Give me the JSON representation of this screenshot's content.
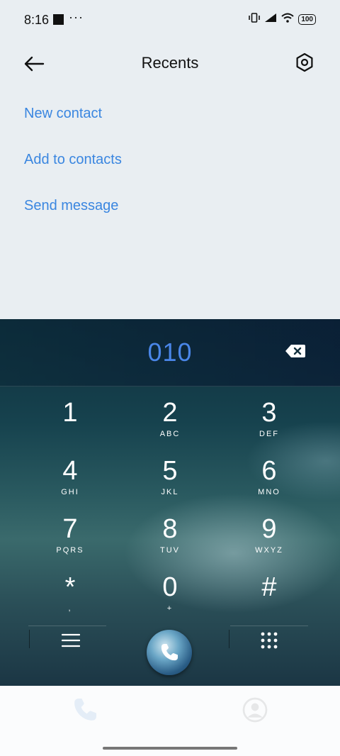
{
  "status_bar": {
    "time": "8:16",
    "dots": "···",
    "battery": "100"
  },
  "header": {
    "title": "Recents"
  },
  "actions": [
    {
      "label": "New contact"
    },
    {
      "label": "Add to contacts"
    },
    {
      "label": "Send message"
    }
  ],
  "dialer": {
    "entered_number": "010",
    "keys": [
      {
        "num": "1",
        "letters": ""
      },
      {
        "num": "2",
        "letters": "ABC"
      },
      {
        "num": "3",
        "letters": "DEF"
      },
      {
        "num": "4",
        "letters": "GHI"
      },
      {
        "num": "5",
        "letters": "JKL"
      },
      {
        "num": "6",
        "letters": "MNO"
      },
      {
        "num": "7",
        "letters": "PQRS"
      },
      {
        "num": "8",
        "letters": "TUV"
      },
      {
        "num": "9",
        "letters": "WXYZ"
      },
      {
        "num": "*",
        "letters": ","
      },
      {
        "num": "0",
        "letters": "+"
      },
      {
        "num": "#",
        "letters": ""
      }
    ]
  },
  "icons": {
    "back": "arrow-left-icon",
    "settings": "hexagon-gear-icon",
    "backspace": "backspace-icon",
    "menu": "hamburger-menu-icon",
    "call": "phone-call-icon",
    "dialpad": "dialpad-grid-icon",
    "recents_tab": "phone-icon",
    "contacts_tab": "person-icon"
  },
  "colors": {
    "accent": "#3a86e0",
    "digits": "#4a86e8",
    "background": "#e9eef2"
  }
}
